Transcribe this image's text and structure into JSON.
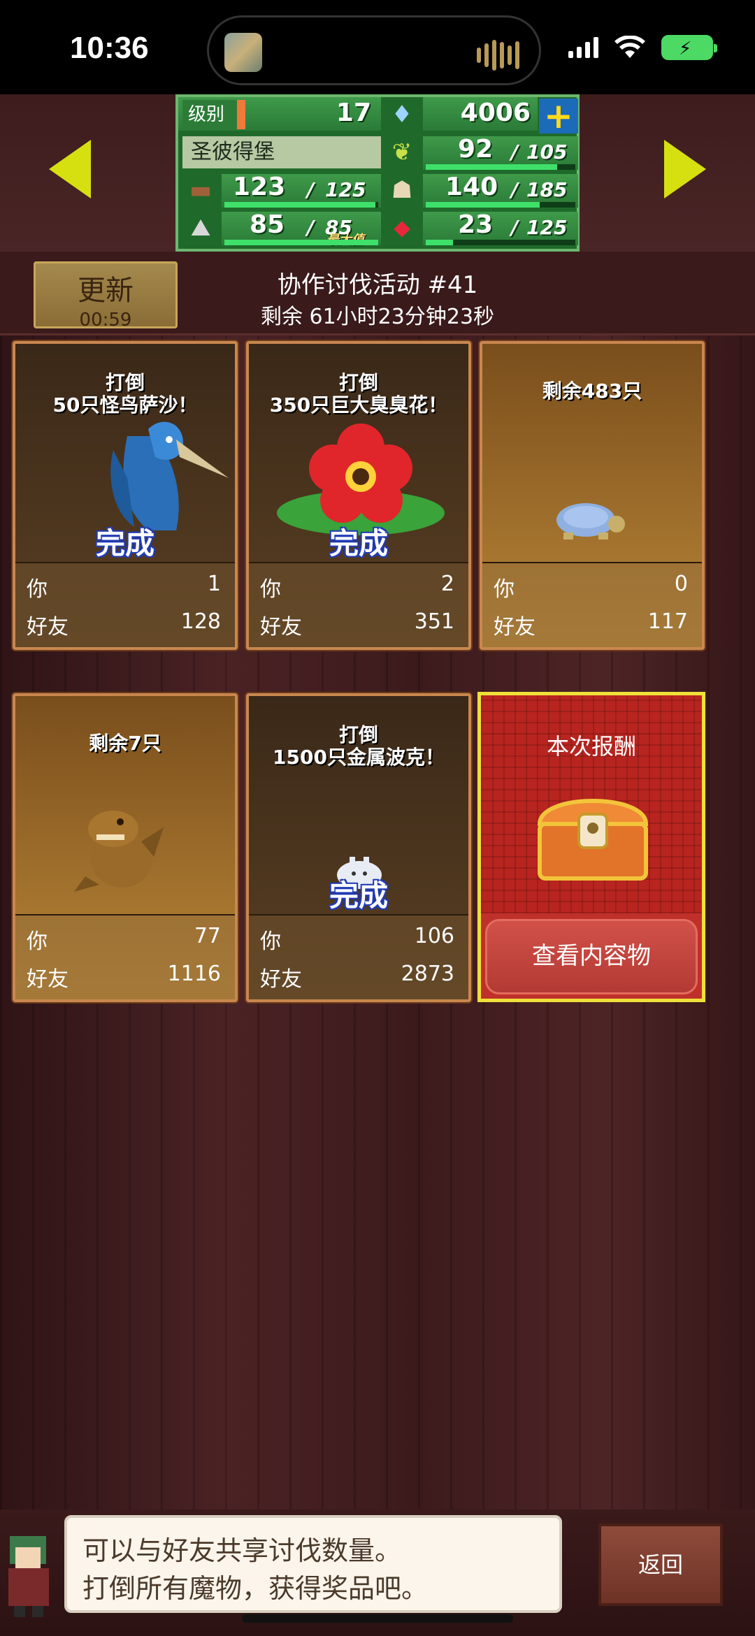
{
  "status_bar": {
    "time": "10:36"
  },
  "resources": {
    "level_label": "级别",
    "level": "17",
    "gems": "4006",
    "city_name": "圣彼得堡",
    "food": "92",
    "food_max": "105",
    "wood": "123",
    "wood_max": "125",
    "population": "140",
    "population_max": "185",
    "stone": "85",
    "stone_max": "85",
    "stone_max_tag": "最大值",
    "ruby": "23",
    "ruby_max": "125"
  },
  "header": {
    "update_label": "更新",
    "update_timer": "00:59",
    "event_title": "协作讨伐活动 #41",
    "event_remaining": "剩余 61小时23分钟23秒"
  },
  "stat_labels": {
    "you": "你",
    "friends": "好友"
  },
  "cards": [
    {
      "title_line1": "打倒",
      "title_line2": "50只怪鸟萨沙！",
      "status": "完成",
      "you": "1",
      "friends": "128"
    },
    {
      "title_line1": "打倒",
      "title_line2": "350只巨大臭臭花！",
      "status": "完成",
      "you": "2",
      "friends": "351"
    },
    {
      "title_line1": "剩余483只",
      "title_line2": "",
      "status": "",
      "you": "0",
      "friends": "117"
    },
    {
      "title_line1": "剩余7只",
      "title_line2": "",
      "status": "",
      "you": "77",
      "friends": "1116"
    },
    {
      "title_line1": "打倒",
      "title_line2": "1500只金属波克！",
      "status": "完成",
      "you": "106",
      "friends": "2873"
    }
  ],
  "reward": {
    "title": "本次报酬",
    "button": "查看内容物"
  },
  "footer": {
    "tip_line1": "可以与好友共享讨伐数量。",
    "tip_line2": "打倒所有魔物，获得奖品吧。",
    "back_label": "返回"
  },
  "colors": {
    "accent_yellow": "#d6e010",
    "done_blue": "#1f3ab5",
    "reward_red": "#b8241f"
  }
}
